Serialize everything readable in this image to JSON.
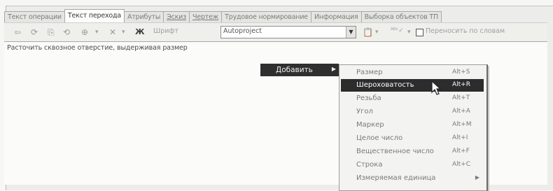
{
  "tabs": [
    {
      "label": "Текст операции"
    },
    {
      "label": "Текст перехода"
    },
    {
      "label": "Атрибуты"
    },
    {
      "label": "Эскиз"
    },
    {
      "label": "Чертеж"
    },
    {
      "label": "Трудовое нормирование"
    },
    {
      "label": "Информация"
    },
    {
      "label": "Выборка объектов ТП"
    }
  ],
  "toolbar": {
    "font_label": "Шрифт",
    "bold_label": "Ж",
    "font_value": "Autoproject",
    "wrap_label": "Переносить по словам",
    "icons": [
      "undo-icon",
      "redo-icon",
      "copy-icon",
      "refresh-icon",
      "insert-icon",
      "delete-icon",
      "paste-icon",
      "spell-check-icon"
    ]
  },
  "editor": {
    "text": "Расточить сквозное отверстие, выдерживая размер"
  },
  "context_menu": {
    "item_label": "Добавить",
    "submenu": [
      {
        "label": "Размер",
        "shortcut": "Alt+S"
      },
      {
        "label": "Шероховатость",
        "shortcut": "Alt+R"
      },
      {
        "label": "Резьба",
        "shortcut": "Alt+T"
      },
      {
        "label": "Угол",
        "shortcut": "Alt+A"
      },
      {
        "label": "Маркер",
        "shortcut": "Alt+M"
      },
      {
        "label": "Целое число",
        "shortcut": "Alt+I"
      },
      {
        "label": "Вещественное число",
        "shortcut": "Alt+F"
      },
      {
        "label": "Строка",
        "shortcut": "Alt+C"
      },
      {
        "label": "Измеряемая единица",
        "shortcut": ""
      }
    ]
  }
}
